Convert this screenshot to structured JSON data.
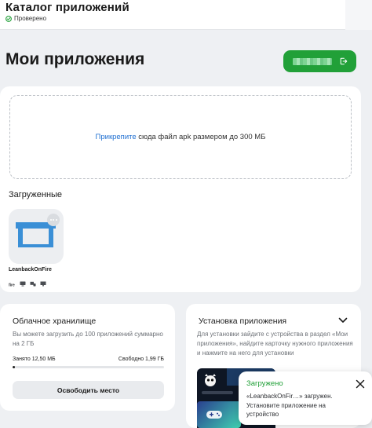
{
  "header": {
    "title": "Каталог приложений",
    "verified_label": "Проверено"
  },
  "page": {
    "title": "Мои приложения",
    "primary_button_icon": "export-icon"
  },
  "upload": {
    "link_text": "Прикрепите",
    "rest_text": " сюда файл apk размером до 300 МБ"
  },
  "uploaded": {
    "section_title": "Загруженные",
    "apps": [
      {
        "name": "LeanbackOnFire",
        "icon": "leanback-icon",
        "platforms": [
          "fire-tv-icon",
          "tv-icon",
          "set-top-box-icon",
          "monitor-icon"
        ]
      }
    ]
  },
  "cloud": {
    "title": "Облачное хранилище",
    "description": "Вы можете загрузить до 100 приложений суммарно на 2 ГБ",
    "used_label": "Занято 12,50 МБ",
    "free_label": "Свободно 1,99 ГБ",
    "used_fraction": 0.006,
    "free_button": "Освободить место"
  },
  "install": {
    "title": "Установка приложения",
    "description": "Для установки зайдите с устройства в раздел «Мои приложения», найдите карточку нужного приложения и нажмите на него для установки"
  },
  "toast": {
    "title": "Загружено",
    "message": "«LeanbackOnFir…» загружен. Установите приложение на устройство"
  },
  "colors": {
    "accent_green": "#21a038",
    "link_blue": "#1f6fd1",
    "leanback_blue": "#3a8fd6"
  }
}
